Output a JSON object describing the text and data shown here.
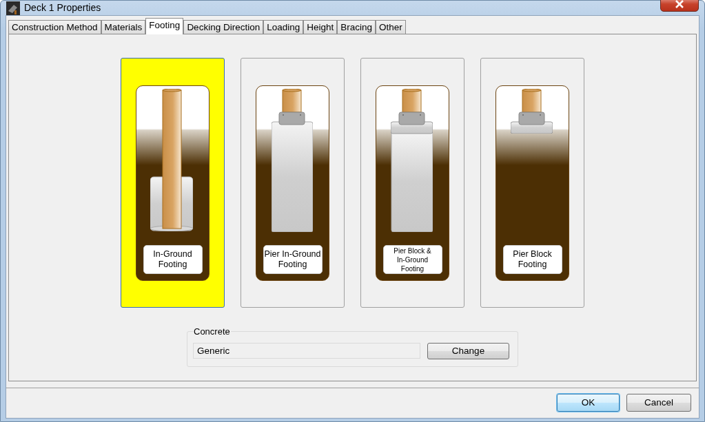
{
  "window": {
    "title": "Deck 1 Properties"
  },
  "tabs": [
    {
      "label": "Construction Method",
      "selected": false
    },
    {
      "label": "Materials",
      "selected": false
    },
    {
      "label": "Footing",
      "selected": true
    },
    {
      "label": "Decking Direction",
      "selected": false
    },
    {
      "label": "Loading",
      "selected": false
    },
    {
      "label": "Height",
      "selected": false
    },
    {
      "label": "Bracing",
      "selected": false
    },
    {
      "label": "Other",
      "selected": false
    }
  ],
  "footing_options": [
    {
      "kind": "post-in-ground",
      "label": "In-Ground Footing",
      "selected": true
    },
    {
      "kind": "pier",
      "label": "Pier In-Ground Footing",
      "selected": false
    },
    {
      "kind": "block-and-pier",
      "label": "Pier Block & In-Ground Footing",
      "selected": false
    },
    {
      "kind": "block",
      "label": "Pier Block Footing",
      "selected": false
    }
  ],
  "concrete": {
    "title": "Concrete",
    "value": "Generic",
    "button": "Change"
  },
  "buttons": [
    {
      "label": "OK",
      "default": true
    },
    {
      "label": "Cancel",
      "default": false
    }
  ]
}
